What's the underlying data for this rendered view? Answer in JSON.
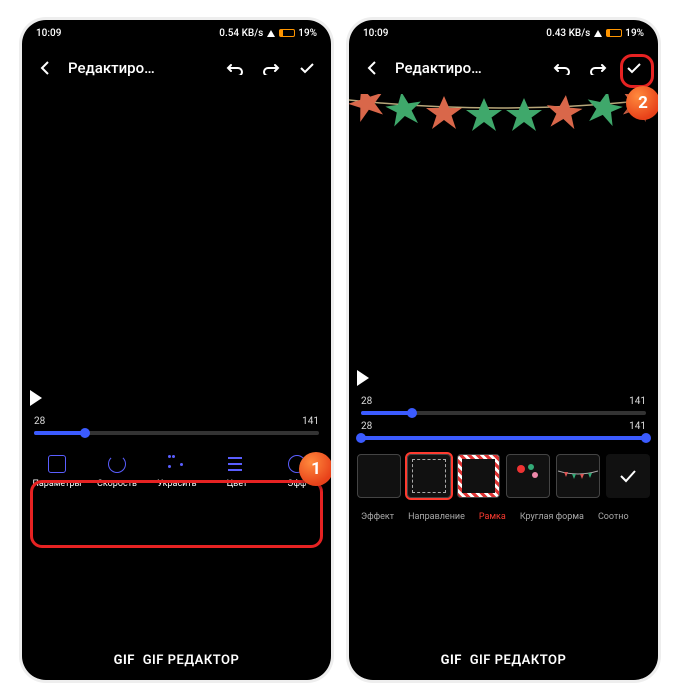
{
  "statusbar": {
    "time_left": "10:09",
    "net_left": "0.54 KB/s",
    "battery_left": "19%",
    "time_right": "10:09",
    "net_right": "0.43 KB/s",
    "battery_right": "19%"
  },
  "appbar": {
    "title": "Редактиро…"
  },
  "timeline": {
    "left": {
      "start": "28",
      "end": "141"
    },
    "right": {
      "start": "28",
      "end": "141",
      "end2": "141"
    }
  },
  "toolbar": {
    "items": [
      {
        "label": "Параметры"
      },
      {
        "label": "Скорость"
      },
      {
        "label": "Украсить"
      },
      {
        "label": "Цвет"
      },
      {
        "label": "Эфф"
      }
    ]
  },
  "tabs": {
    "items": [
      {
        "label": "Эффект"
      },
      {
        "label": "Направление"
      },
      {
        "label": "Рамка"
      },
      {
        "label": "Круглая форма"
      },
      {
        "label": "Соотно"
      }
    ],
    "active_index": 2
  },
  "footer": {
    "gif": "GIF",
    "label": "GIF РЕДАКТОР"
  },
  "callouts": {
    "n1": "1",
    "n2": "2"
  }
}
